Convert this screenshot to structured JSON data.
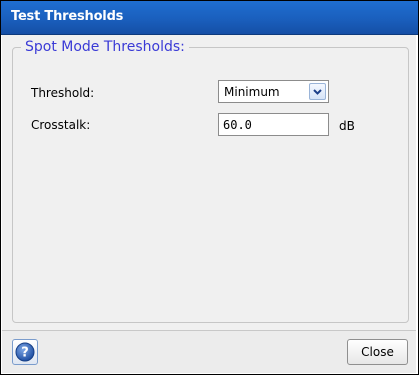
{
  "window": {
    "title": "Test Thresholds"
  },
  "group": {
    "legend": "Spot Mode Thresholds:"
  },
  "fields": {
    "threshold": {
      "label": "Threshold:",
      "selected": "Minimum"
    },
    "crosstalk": {
      "label": "Crosstalk:",
      "value": "60.0",
      "unit": "dB"
    }
  },
  "footer": {
    "close_label": "Close",
    "help_icon": "question-mark-icon"
  },
  "colors": {
    "title_bar": "#1a5fbd",
    "legend_text": "#3a3ad6"
  }
}
